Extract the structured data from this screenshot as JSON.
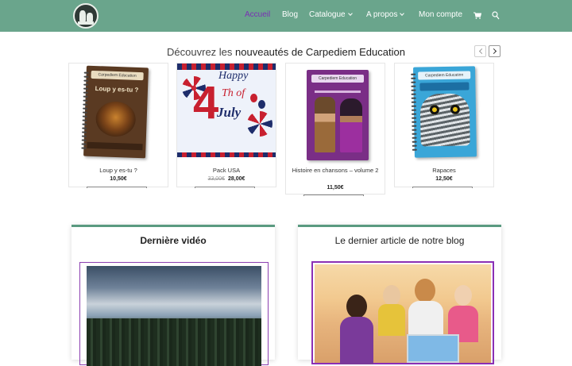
{
  "header": {
    "nav": [
      {
        "label": "Accueil",
        "active": true
      },
      {
        "label": "Blog"
      },
      {
        "label": "Catalogue",
        "dropdown": true
      },
      {
        "label": "A propos",
        "dropdown": true
      },
      {
        "label": "Mon compte"
      }
    ],
    "icons": [
      "logo-icon",
      "cart-icon",
      "search-icon"
    ],
    "bar_color": "#6aa58c",
    "active_color": "#7b2fb5"
  },
  "slider": {
    "title_prefix": "Découvrez les",
    "title_bold": "nouveautés de Carpediem Education"
  },
  "products": [
    {
      "name": "Loup y es-tu ?",
      "price": "10,50€",
      "cover_text": "Loup y es-tu ?",
      "brand": "Carpediem Education"
    },
    {
      "name": "Pack USA",
      "old_price": "33,00€",
      "price": "28,00€",
      "cover_text_1": "Happy",
      "cover_text_2": "4",
      "cover_text_3": "Th of",
      "cover_text_4": "July"
    },
    {
      "name": "Histoire en chansons – volume 2",
      "price": "11,50€",
      "brand": "Carpediem Education"
    },
    {
      "name": "Rapaces",
      "price": "12,50€",
      "brand": "Carpediem Education"
    }
  ],
  "panels": {
    "video_title": "Dernière vidéo",
    "blog_title": "Le dernier article de notre blog"
  }
}
